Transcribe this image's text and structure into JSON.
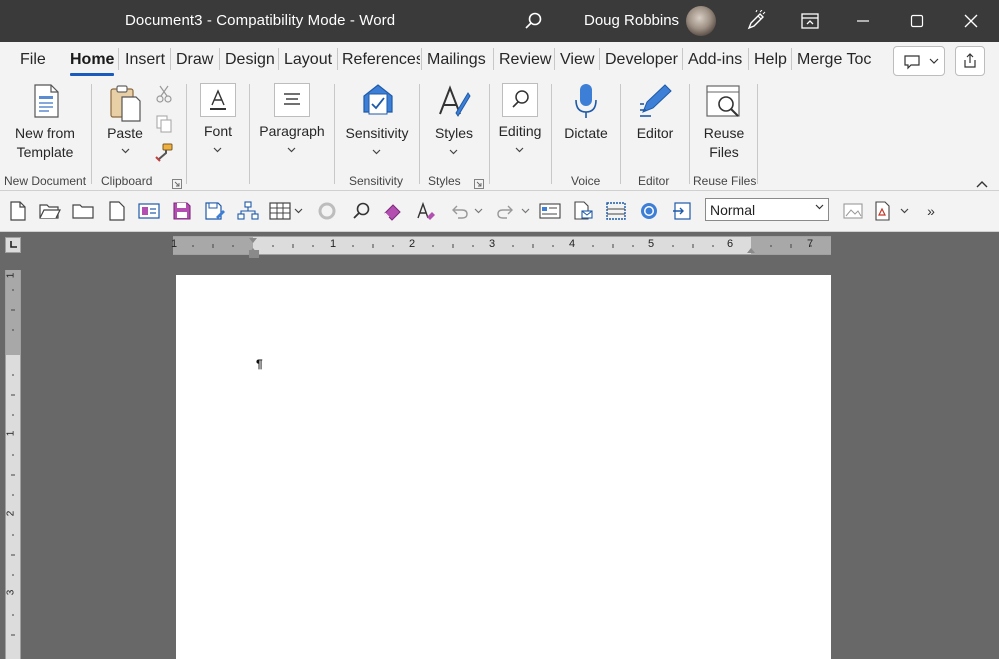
{
  "titlebar": {
    "title": "Document3  -  Compatibility Mode  -  Word",
    "user": "Doug Robbins"
  },
  "tabs": [
    "File",
    "Home",
    "Insert",
    "Draw",
    "Design",
    "Layout",
    "References",
    "Mailings",
    "Review",
    "View",
    "Developer",
    "Add-ins",
    "Help",
    "Merge Toc"
  ],
  "active_tab": "Home",
  "ribbon": {
    "new_from_template": [
      "New from",
      "Template"
    ],
    "paste": "Paste",
    "font": "Font",
    "paragraph": "Paragraph",
    "sensitivity": "Sensitivity",
    "styles": "Styles",
    "editing": "Editing",
    "dictate": "Dictate",
    "editor": "Editor",
    "reuse_files": [
      "Reuse",
      "Files"
    ],
    "groups": {
      "new_document": "New Document",
      "clipboard": "Clipboard",
      "sensitivity": "Sensitivity",
      "styles": "Styles",
      "voice": "Voice",
      "editor": "Editor",
      "reuse_files": "Reuse Files"
    }
  },
  "qat": {
    "style_value": "Normal",
    "more": "»"
  },
  "ruler": {
    "h_numbers": [
      "1",
      "1",
      "2",
      "3",
      "4",
      "5",
      "6",
      "7"
    ],
    "v_numbers": [
      "1",
      "1",
      "2",
      "3"
    ]
  },
  "document": {
    "paragraph_mark": "¶"
  }
}
